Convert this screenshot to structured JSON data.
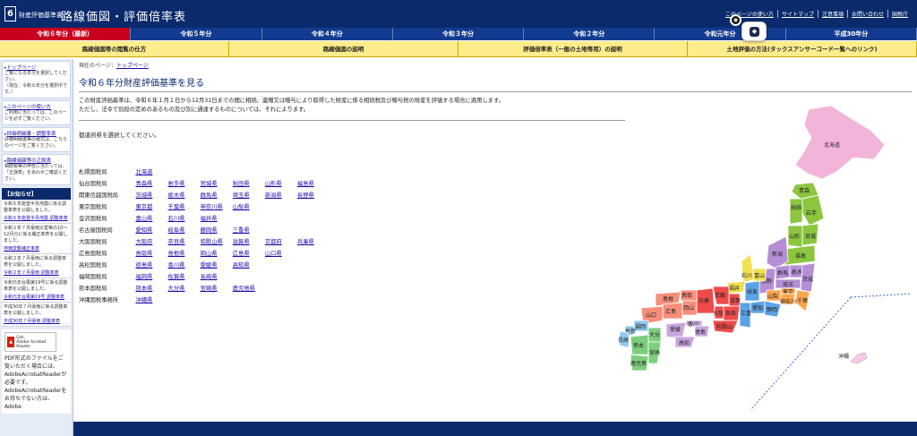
{
  "header": {
    "logo_number": "6",
    "logo_small": "財産評価基準書",
    "logo_main": "路線価図・評価倍率表",
    "links": [
      "このページの使い方",
      "サイトマップ",
      "注意事項",
      "お問い合わせ",
      "国税庁"
    ]
  },
  "year_tabs": [
    "令和６年分（最新）",
    "令和５年分",
    "令和４年分",
    "令和３年分",
    "令和２年分",
    "令和元年分",
    "平成30年分"
  ],
  "guide_tabs": [
    "路線価図等の閲覧の仕方",
    "路線価図の説明",
    "評価倍率表（一般の土地等用）の説明",
    "土地評価の方法(タックスアンサーコード一覧へのリンク)"
  ],
  "sidebar": {
    "top_link": "トップページ",
    "top_desc": "ご覧になる年分を選択してください。",
    "top_note": "（現在、令和６年分を選択中です。）",
    "howto_link": "このページの使い方",
    "howto_desc": "ご利用に当たっては、このページを必ずご覧ください。",
    "revision_link": "評価明細書・調整率表",
    "revision_desc": "評価明細書等の様式は、こちらのページをご覧ください。",
    "seal_link": "路線価図等の正誤表",
    "seal_desc": "相続税等の申告に当たっては、「正誤表」をあわせご確認ください。",
    "oshirase_title": "【お知らせ】",
    "news": [
      {
        "text": "令和６年能登半島地震に係る調整率表を公開しました。",
        "link": "令和６年能登半島地震 調整率表"
      },
      {
        "text": "令和２年７月豪雨災害等の10～12月分に係る補正率表を公開しました。",
        "link": "地価変動補正率表"
      },
      {
        "text": "令和２年７月豪雨に係る調整率表を公開しました。",
        "link": "令和２年７月豪雨 調整率表"
      },
      {
        "text": "令和元年台風第19号に係る調整率表を公開しました。",
        "link": "令和元年台風第19号 調整率表"
      },
      {
        "text": "平成30年７月豪雨に係る調整率表を公開しました。",
        "link": "平成30年７月豪雨 調整率表"
      }
    ],
    "acrobat_badge_get": "Get",
    "acrobat_badge_name": "Adobe Acrobat Reader",
    "acrobat_desc": "PDF形式のファイルをご覧いただく場合には、AdobeAcrobatReaderが必要です。AdobeAcrobatReaderをお持ちでない方は、Adobe"
  },
  "main": {
    "breadcrumb_label": "現在のページ：",
    "breadcrumb_link": "トップページ",
    "title": "令和６年分財産評価基準を見る",
    "intro_1": "この財産評価基準は、令和６年１月１日から12月31日までの間に相続、遺贈又は贈与により取得した財産に係る相続税及び贈与税の財産を評価する場合に適用します。",
    "intro_2": "ただし、法令で別段の定めのあるもの及び別に通達するものについては、それによります。",
    "select_msg": "都道府県を選択してください。"
  },
  "bureaus": [
    {
      "name": "札幌国税局",
      "prefs": [
        "北海道"
      ]
    },
    {
      "name": "仙台国税局",
      "prefs": [
        "青森県",
        "岩手県",
        "宮城県",
        "秋田県",
        "山形県",
        "福島県"
      ]
    },
    {
      "name": "関東信越国税局",
      "prefs": [
        "茨城県",
        "栃木県",
        "群馬県",
        "埼玉県",
        "新潟県",
        "長野県"
      ]
    },
    {
      "name": "東京国税局",
      "prefs": [
        "東京都",
        "千葉県",
        "神奈川県",
        "山梨県"
      ]
    },
    {
      "name": "金沢国税局",
      "prefs": [
        "富山県",
        "石川県",
        "福井県"
      ]
    },
    {
      "name": "名古屋国税局",
      "prefs": [
        "愛知県",
        "岐阜県",
        "静岡県",
        "三重県"
      ]
    },
    {
      "name": "大阪国税局",
      "prefs": [
        "大阪府",
        "奈良県",
        "和歌山県",
        "滋賀県",
        "京都府",
        "兵庫県"
      ]
    },
    {
      "name": "広島国税局",
      "prefs": [
        "鳥取県",
        "島根県",
        "岡山県",
        "広島県",
        "山口県"
      ]
    },
    {
      "name": "高松国税局",
      "prefs": [
        "徳島県",
        "香川県",
        "愛媛県",
        "高知県"
      ]
    },
    {
      "name": "福岡国税局",
      "prefs": [
        "福岡県",
        "佐賀県",
        "長崎県"
      ]
    },
    {
      "name": "熊本国税局",
      "prefs": [
        "熊本県",
        "大分県",
        "宮崎県",
        "鹿児島県"
      ]
    },
    {
      "name": "沖縄国税事務所",
      "prefs": [
        "沖縄県"
      ]
    }
  ],
  "map_labels": {
    "hokkaido": "北海道",
    "aomori": "青森",
    "iwate": "岩手",
    "akita": "秋田",
    "miyagi": "宮城",
    "yamagata": "山形",
    "fukushima": "福島",
    "niigata": "新潟",
    "ishikawa": "石川",
    "toyama": "富山",
    "fukui": "福井",
    "nagano": "長野",
    "gunma": "群馬",
    "tochigi": "栃木",
    "ibaraki": "茨城",
    "saitama": "埼玉",
    "chiba": "千葉",
    "tokyo": "東京",
    "yamanashi": "山梨",
    "kanagawa": "神奈川",
    "shizuoka": "静岡",
    "gifu": "岐阜",
    "aichi": "愛知",
    "shiga": "滋賀",
    "kyoto": "京都",
    "osaka": "大阪",
    "nara": "奈良",
    "mie": "三重",
    "wakayama": "和歌山",
    "hyogo": "兵庫",
    "tottori": "鳥取",
    "shimane": "島根",
    "okayama": "岡山",
    "hiroshima": "広島",
    "yamaguchi": "山口",
    "kagawa": "香川",
    "tokushima": "徳島",
    "ehime": "愛媛",
    "kochi": "高知",
    "fukuoka": "福岡",
    "saga": "佐賀",
    "nagasaki": "長崎",
    "oita": "大分",
    "kumamoto": "熊本",
    "miyazaki": "宮崎",
    "kagoshima": "鹿児島",
    "okinawa": "沖縄"
  },
  "fab_icon": "chat-icon",
  "colors": {
    "header": "#0a2a6b",
    "active_tab": "#c8001e",
    "guide_bar": "#ffec8b"
  }
}
